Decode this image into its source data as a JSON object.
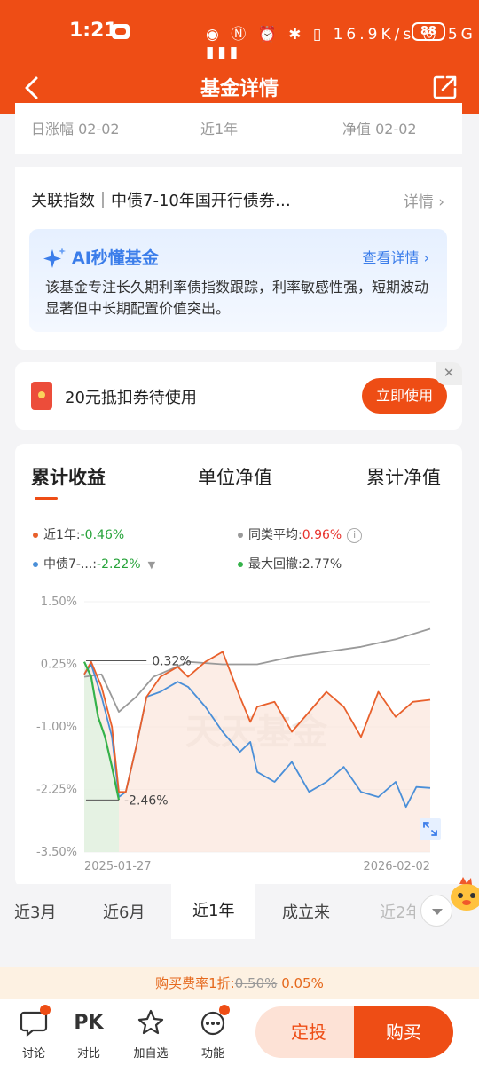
{
  "status_bar": {
    "time": "1:21",
    "right_text": "◉ Ⓝ ⏰ ✱ ▯ 16.9K/s ◎ 5G ▮▮▮",
    "battery": "88"
  },
  "nav": {
    "title": "基金详情"
  },
  "summary": {
    "label_daily": "日涨幅 02-02",
    "label_period": "近1年",
    "label_nav": "净值 02-02"
  },
  "index": {
    "label": "关联指数｜中债7-10年国开行债券…",
    "more": "详情 ›"
  },
  "ai_card": {
    "title": "AI秒懂基金",
    "more": "查看详情 ›",
    "desc": "该基金专注长久期利率债指数跟踪，利率敏感性强，短期波动显著但中长期配置价值突出。"
  },
  "coupon": {
    "text": "20元抵扣券待使用",
    "button": "立即使用",
    "close": "✕"
  },
  "tabs": [
    "累计收益",
    "单位净值",
    "累计净值"
  ],
  "legend": {
    "fund_label": "近1年:",
    "fund_value": "-0.46%",
    "peer_label": "同类平均:",
    "peer_value": "0.96%",
    "index_label": "中债7-...:",
    "index_value": "-2.22%",
    "drawdown_label": "最大回撤:",
    "drawdown_value": "2.77%"
  },
  "colors": {
    "fund": "#e8602c",
    "peer": "#9a9a9a",
    "index": "#4a8fd8",
    "drawdown": "#35b24a",
    "accent": "#ee4d15"
  },
  "chart_data": {
    "type": "line",
    "title": "",
    "xlabel": "",
    "ylabel": "",
    "x_ticks": [
      "2025-01-27",
      "2026-02-02"
    ],
    "y_ticks": [
      "1.50%",
      "0.25%",
      "-1.00%",
      "-2.25%",
      "-3.50%"
    ],
    "ylim": [
      -3.5,
      1.5
    ],
    "watermark": "天天基金",
    "annotations": [
      {
        "text": "0.32%",
        "x": 0.18,
        "y": 0.32
      },
      {
        "text": "-2.46%",
        "x": 0.1,
        "y": -2.46
      }
    ],
    "series": [
      {
        "name": "近1年",
        "x": [
          0,
          0.02,
          0.05,
          0.08,
          0.1,
          0.12,
          0.15,
          0.18,
          0.22,
          0.27,
          0.3,
          0.35,
          0.4,
          0.45,
          0.48,
          0.5,
          0.55,
          0.6,
          0.65,
          0.7,
          0.75,
          0.8,
          0.85,
          0.9,
          0.95,
          1.0
        ],
        "values": [
          0.05,
          0.3,
          -0.2,
          -1.0,
          -2.3,
          -2.3,
          -1.4,
          -0.4,
          0.0,
          0.2,
          0.0,
          0.3,
          0.5,
          -0.4,
          -0.9,
          -0.6,
          -0.5,
          -1.1,
          -0.7,
          -0.3,
          -0.6,
          -1.2,
          -0.3,
          -0.8,
          -0.5,
          -0.46
        ]
      },
      {
        "name": "同类平均",
        "x": [
          0,
          0.05,
          0.1,
          0.15,
          0.2,
          0.3,
          0.4,
          0.5,
          0.6,
          0.7,
          0.8,
          0.9,
          1.0
        ],
        "values": [
          0.0,
          0.05,
          -0.7,
          -0.4,
          0.0,
          0.3,
          0.25,
          0.25,
          0.4,
          0.5,
          0.6,
          0.75,
          0.96
        ]
      },
      {
        "name": "中债7-...",
        "x": [
          0,
          0.02,
          0.05,
          0.08,
          0.1,
          0.12,
          0.15,
          0.18,
          0.22,
          0.27,
          0.3,
          0.35,
          0.4,
          0.45,
          0.48,
          0.5,
          0.55,
          0.6,
          0.65,
          0.7,
          0.75,
          0.8,
          0.85,
          0.9,
          0.93,
          0.96,
          1.0
        ],
        "values": [
          0.05,
          0.25,
          -0.4,
          -1.2,
          -2.4,
          -2.3,
          -1.4,
          -0.4,
          -0.3,
          -0.1,
          -0.2,
          -0.6,
          -1.1,
          -1.5,
          -1.3,
          -1.9,
          -2.1,
          -1.7,
          -2.3,
          -2.1,
          -1.8,
          -2.3,
          -2.4,
          -2.1,
          -2.6,
          -2.2,
          -2.22
        ]
      }
    ],
    "drawdown": {
      "name": "最大回撤",
      "x": [
        0,
        0.02,
        0.04,
        0.06,
        0.08,
        0.1
      ],
      "values": [
        0.3,
        0.0,
        -0.8,
        -1.2,
        -1.8,
        -2.46
      ]
    }
  },
  "periods": [
    "近3月",
    "近6月",
    "近1年",
    "成立来",
    "近2年"
  ],
  "fee": {
    "prefix": "购买费率1折:",
    "old": "0.50%",
    "new": "0.05%"
  },
  "bottom": {
    "discuss": "讨论",
    "compare_icon": "PK",
    "compare": "对比",
    "watch": "加自选",
    "function": "功能",
    "fixed": "定投",
    "buy": "购买"
  }
}
